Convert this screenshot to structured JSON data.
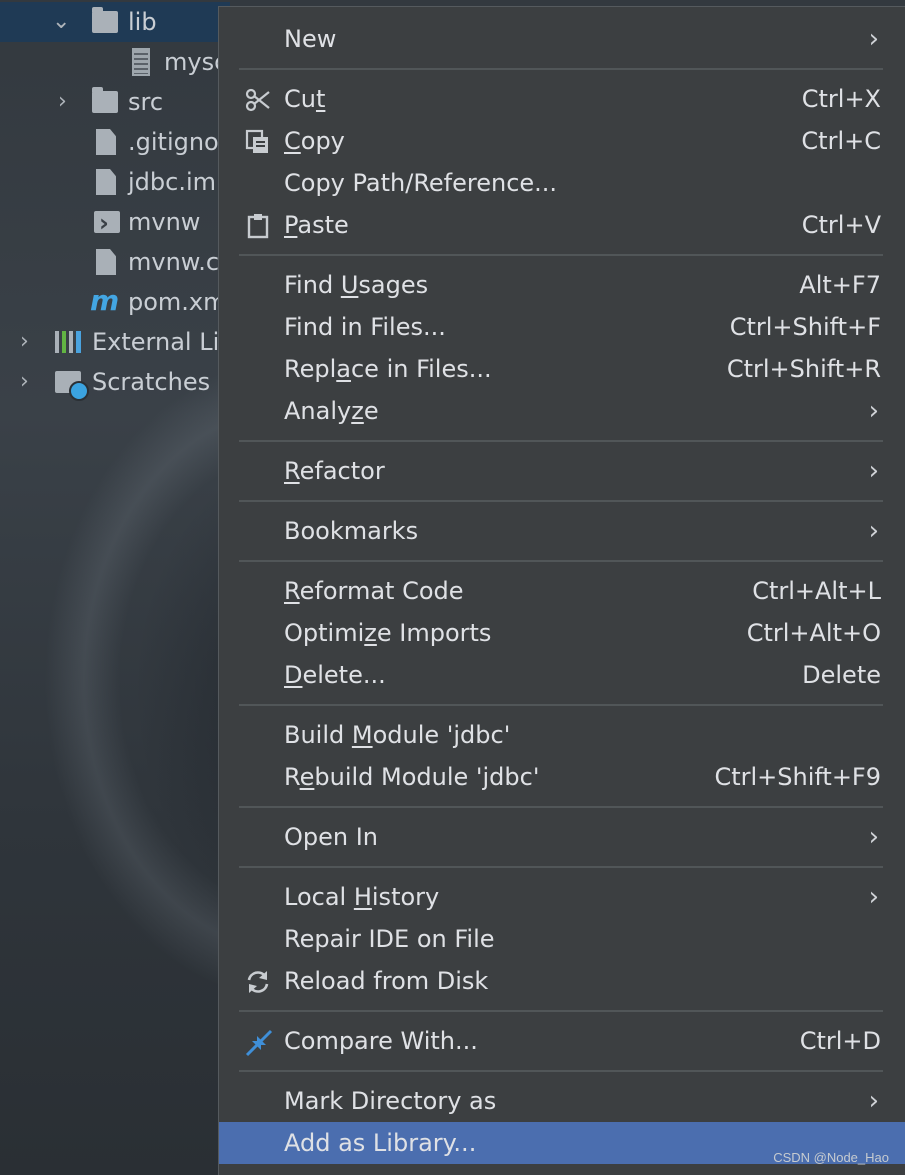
{
  "tree": {
    "items": [
      {
        "label": "lib",
        "expanded": true,
        "icon": "folder-icon"
      },
      {
        "label": "mysc",
        "icon": "archive-file-icon"
      },
      {
        "label": "src",
        "expanded": false,
        "icon": "folder-icon"
      },
      {
        "label": ".gitignor",
        "icon": "ignored-file-icon"
      },
      {
        "label": "jdbc.iml",
        "icon": "module-file-icon"
      },
      {
        "label": "mvnw",
        "icon": "shell-script-icon"
      },
      {
        "label": "mvnw.cı",
        "icon": "text-file-icon"
      },
      {
        "label": "pom.xm",
        "icon": "maven-icon"
      },
      {
        "label": "External Lib",
        "expanded": false,
        "icon": "external-libraries-icon"
      },
      {
        "label": "Scratches a",
        "expanded": false,
        "icon": "scratches-icon"
      }
    ],
    "chevron_expanded": "⌄",
    "chevron_collapsed": "›",
    "maven_glyph": "m"
  },
  "menu": {
    "new": {
      "label": "New"
    },
    "cut": {
      "pre": "Cu",
      "u": "t",
      "post": "",
      "shortcut": "Ctrl+X",
      "icon": "scissors-icon"
    },
    "copy": {
      "pre": "",
      "u": "C",
      "post": "opy",
      "shortcut": "Ctrl+C",
      "icon": "copy-icon"
    },
    "copy_path": {
      "label": "Copy Path/Reference..."
    },
    "paste": {
      "pre": "",
      "u": "P",
      "post": "aste",
      "shortcut": "Ctrl+V",
      "icon": "clipboard-icon"
    },
    "find_usages": {
      "pre": "Find ",
      "u": "U",
      "post": "sages",
      "shortcut": "Alt+F7"
    },
    "find_in_files": {
      "label": "Find in Files...",
      "shortcut": "Ctrl+Shift+F"
    },
    "replace_in_files": {
      "pre": "Repl",
      "u": "a",
      "post": "ce in Files...",
      "shortcut": "Ctrl+Shift+R"
    },
    "analyze": {
      "pre": "Analy",
      "u": "z",
      "post": "e"
    },
    "refactor": {
      "pre": "",
      "u": "R",
      "post": "efactor"
    },
    "bookmarks": {
      "label": "Bookmarks"
    },
    "reformat": {
      "pre": "",
      "u": "R",
      "post": "eformat Code",
      "shortcut": "Ctrl+Alt+L"
    },
    "optimize": {
      "pre": "Optimi",
      "u": "z",
      "post": "e Imports",
      "shortcut": "Ctrl+Alt+O"
    },
    "delete": {
      "pre": "",
      "u": "D",
      "post": "elete...",
      "shortcut": "Delete"
    },
    "build_module": {
      "pre": "Build ",
      "u": "M",
      "post": "odule 'jdbc'"
    },
    "rebuild_module": {
      "pre": "R",
      "u": "e",
      "post": "build Module 'jdbc'",
      "shortcut": "Ctrl+Shift+F9"
    },
    "open_in": {
      "label": "Open In"
    },
    "local_history": {
      "pre": "Local ",
      "u": "H",
      "post": "istory"
    },
    "repair_ide": {
      "label": "Repair IDE on File"
    },
    "reload": {
      "label": "Reload from Disk",
      "icon": "reload-icon"
    },
    "compare": {
      "label": "Compare With...",
      "shortcut": "Ctrl+D",
      "icon": "compare-icon"
    },
    "mark_dir": {
      "label": "Mark Directory as"
    },
    "add_library": {
      "label": "Add as Library..."
    },
    "submenu_arrow": "›"
  },
  "watermark": "CSDN @Node_Hao",
  "colors": {
    "menu_bg": "#3c3f41",
    "selection": "#4b6eaf",
    "text": "#dfe1e5",
    "tree_selection": "#1f3a55"
  }
}
